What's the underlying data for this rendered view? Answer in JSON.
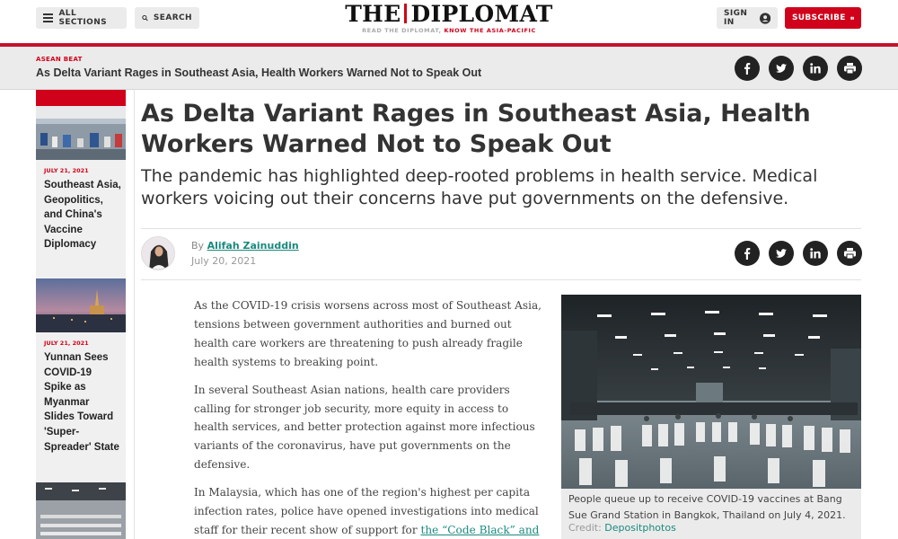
{
  "header": {
    "sections_label": "ALL SECTIONS",
    "search_label": "SEARCH",
    "signin_label": "SIGN IN",
    "subscribe_label": "SUBSCRIBE",
    "logo_left": "THE",
    "logo_right": "DIPLOMAT",
    "tagline_grey": "READ THE DIPLOMAT,",
    "tagline_red": "KNOW THE ASIA-PACIFIC"
  },
  "sticky": {
    "kicker": "ASEAN BEAT",
    "title": "As Delta Variant Rages in Southeast Asia, Health Workers Warned Not to Speak Out"
  },
  "rail": {
    "items": [
      {
        "date": "JULY 21, 2021",
        "title": "Southeast Asia, Geopolitics, and China's Vaccine Diplomacy"
      },
      {
        "date": "JULY 21, 2021",
        "title": "Yunnan Sees COVID-19 Spike as Myanmar Slides Toward 'Super-Spreader' State"
      }
    ]
  },
  "article": {
    "headline": "As Delta Variant Rages in Southeast Asia, Health Workers Warned Not to Speak Out",
    "dek": "The pandemic has highlighted deep-rooted problems in health service. Medical workers voicing out their concerns have put governments on the defensive.",
    "by": "By",
    "author": "Alifah Zainuddin",
    "date": "July 20, 2021",
    "paragraphs": [
      "As the COVID-19 crisis worsens across most of Southeast Asia, tensions between government authorities and burned out health care workers are threatening to push already fragile health systems to breaking point.",
      "In several Southeast Asian nations, health care providers calling for stronger job security, more equity in access to health services, and better protection against more infectious variants of the coronavirus, have put governments on the defensive."
    ],
    "p3_text": "In Malaysia, which has one of the region's highest per capita infection rates, police have opened investigations into medical staff for their recent show of support for ",
    "p3_link": "the “Code Black” and",
    "photo_caption": "People queue up to receive COVID-19 vaccines at Bang Sue Grand Station in Bangkok, Thailand on July 4, 2021.",
    "credit_label": "Credit:",
    "credit_value": "Depositphotos"
  },
  "share_icons": [
    "facebook-icon",
    "twitter-icon",
    "linkedin-icon",
    "print-icon"
  ],
  "colors": {
    "brand_red": "#d0021b",
    "link_teal": "#1a8a7e",
    "dark": "#222222"
  }
}
